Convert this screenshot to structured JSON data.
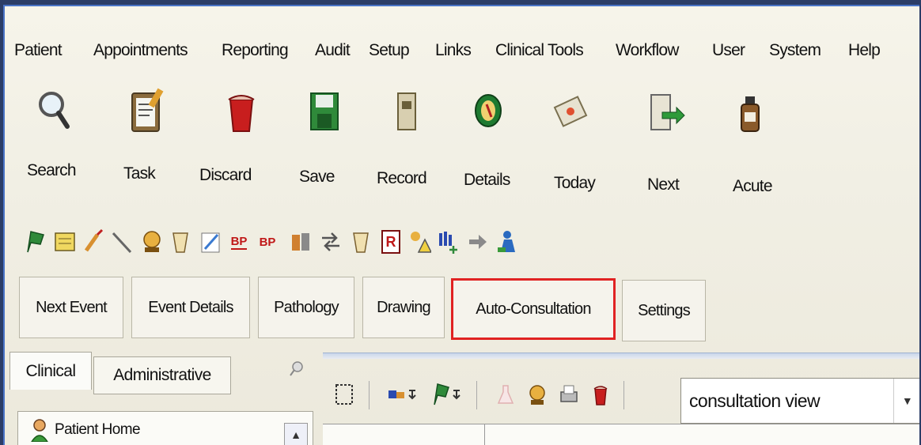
{
  "menu": {
    "items": [
      "Patient",
      "Appointments",
      "Reporting",
      "Audit",
      "Setup",
      "Links",
      "Clinical Tools",
      "Workflow",
      "User",
      "System",
      "Help"
    ]
  },
  "toolbar": {
    "buttons": [
      {
        "label": "Search",
        "icon": "magnifier-icon"
      },
      {
        "label": "Task",
        "icon": "clipboard-icon"
      },
      {
        "label": "Discard",
        "icon": "bin-icon"
      },
      {
        "label": "Save",
        "icon": "floppy-disk-icon"
      },
      {
        "label": "Record",
        "icon": "record-icon"
      },
      {
        "label": "Details",
        "icon": "details-icon"
      },
      {
        "label": "Today",
        "icon": "calendar-icon"
      },
      {
        "label": "Next",
        "icon": "next-icon"
      },
      {
        "label": "Acute",
        "icon": "medicine-bottle-icon"
      }
    ]
  },
  "small_toolbar": {
    "bp1": "BP",
    "bp2": "BP",
    "r": "R"
  },
  "tabs": {
    "next_event": "Next Event",
    "event_details": "Event Details",
    "pathology": "Pathology",
    "drawing": "Drawing",
    "auto_consultation": "Auto-Consultation",
    "settings": "Settings"
  },
  "nav": {
    "clinical": "Clinical",
    "administrative": "Administrative",
    "patient_home": "Patient Home"
  },
  "view": {
    "selected": "consultation view"
  },
  "colors": {
    "highlight": "#e02222",
    "window_border": "#4a74c7"
  }
}
